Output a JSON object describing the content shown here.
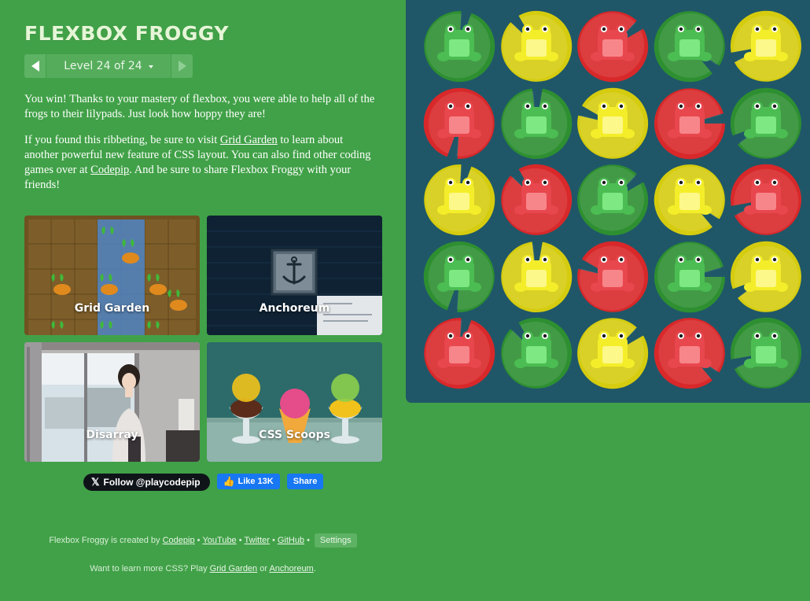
{
  "app": {
    "title": "FLEXBOX FROGGY",
    "level_label": "Level 24 of 24"
  },
  "content": {
    "para1": "You win! Thanks to your mastery of flexbox, you were able to help all of the frogs to their lilypads. Just look how hoppy they are!",
    "para2_a": "If you found this ribbeting, be sure to visit ",
    "para2_link1": "Grid Garden",
    "para2_b": " to learn about another powerful new feature of CSS layout. You can also find other coding games over at ",
    "para2_link2": "Codepip",
    "para2_c": ". And be sure to share Flexbox Froggy with your friends!"
  },
  "games": [
    {
      "name": "Grid Garden"
    },
    {
      "name": "Anchoreum"
    },
    {
      "name": "Disarray"
    },
    {
      "name": "CSS Scoops"
    }
  ],
  "social": {
    "x_follow": "Follow @playcodepip",
    "fb_like": "Like 13K",
    "fb_share": "Share"
  },
  "footer": {
    "created_by": "Flexbox Froggy is created by",
    "codepip": "Codepip",
    "youtube": "YouTube",
    "twitter": "Twitter",
    "github": "GitHub",
    "settings": "Settings",
    "learn_more": "Want to learn more CSS? Play",
    "grid_garden": "Grid Garden",
    "or": "or",
    "anchoreum": "Anchoreum",
    "period": "."
  },
  "colors": {
    "background": "#41a148",
    "board": "#1f5768",
    "green_pad": "#2e8f31",
    "red_pad": "#d8282a",
    "yellow_pad": "#d5cc0f",
    "green_frog": "#4bbd52",
    "red_frog": "#e8474e",
    "yellow_frog": "#f4ee2a"
  },
  "board": {
    "rows": [
      [
        "green",
        "yellow",
        "red",
        "green",
        "yellow"
      ],
      [
        "red",
        "green",
        "yellow",
        "red",
        "green"
      ],
      [
        "yellow",
        "red",
        "green",
        "yellow",
        "red"
      ],
      [
        "green",
        "yellow",
        "red",
        "green",
        "yellow"
      ],
      [
        "red",
        "green",
        "yellow",
        "red",
        "green"
      ]
    ]
  }
}
